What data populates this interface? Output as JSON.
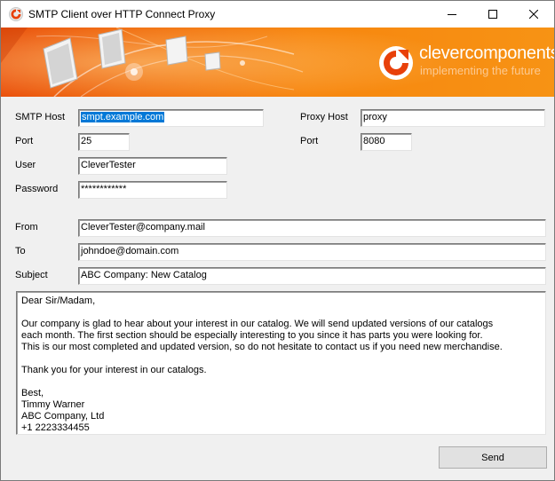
{
  "window": {
    "title": "SMTP Client over HTTP Connect Proxy"
  },
  "banner": {
    "brand_name": "clevercomponents",
    "brand_tagline": "implementing the future"
  },
  "form": {
    "smtp_host": {
      "label": "SMTP Host",
      "value": "smpt.example.com"
    },
    "port": {
      "label": "Port",
      "value": "25"
    },
    "user": {
      "label": "User",
      "value": "CleverTester"
    },
    "password": {
      "label": "Password",
      "value": "************"
    },
    "proxy_host": {
      "label": "Proxy Host",
      "value": "proxy"
    },
    "proxy_port": {
      "label": "Port",
      "value": "8080"
    },
    "from": {
      "label": "From",
      "value": "CleverTester@company.mail"
    },
    "to": {
      "label": "To",
      "value": "johndoe@domain.com"
    },
    "subject": {
      "label": "Subject",
      "value": "ABC Company: New Catalog"
    }
  },
  "message": {
    "lines": [
      "Dear Sir/Madam,",
      "",
      "Our company is glad to hear about your interest in our catalog. We will send updated versions of our catalogs",
      "each month. The first section should be especially interesting to you since it has parts you were looking for.",
      "This is our most completed and updated version, so do not hesitate to contact us if you need new merchandise.",
      "",
      "Thank you for your interest in our catalogs.",
      "",
      "Best,",
      "Timmy Warner",
      "ABC Company, Ltd",
      "+1 2223334455"
    ]
  },
  "buttons": {
    "send": "Send"
  },
  "icons": {
    "app": "app-icon",
    "minimize": "minimize-icon",
    "maximize": "maximize-icon",
    "close": "close-icon",
    "logo": "clevercomponents-logo-icon"
  },
  "colors": {
    "banner_start": "#e94a06",
    "banner_end": "#f79314",
    "selection": "#0078d7"
  }
}
